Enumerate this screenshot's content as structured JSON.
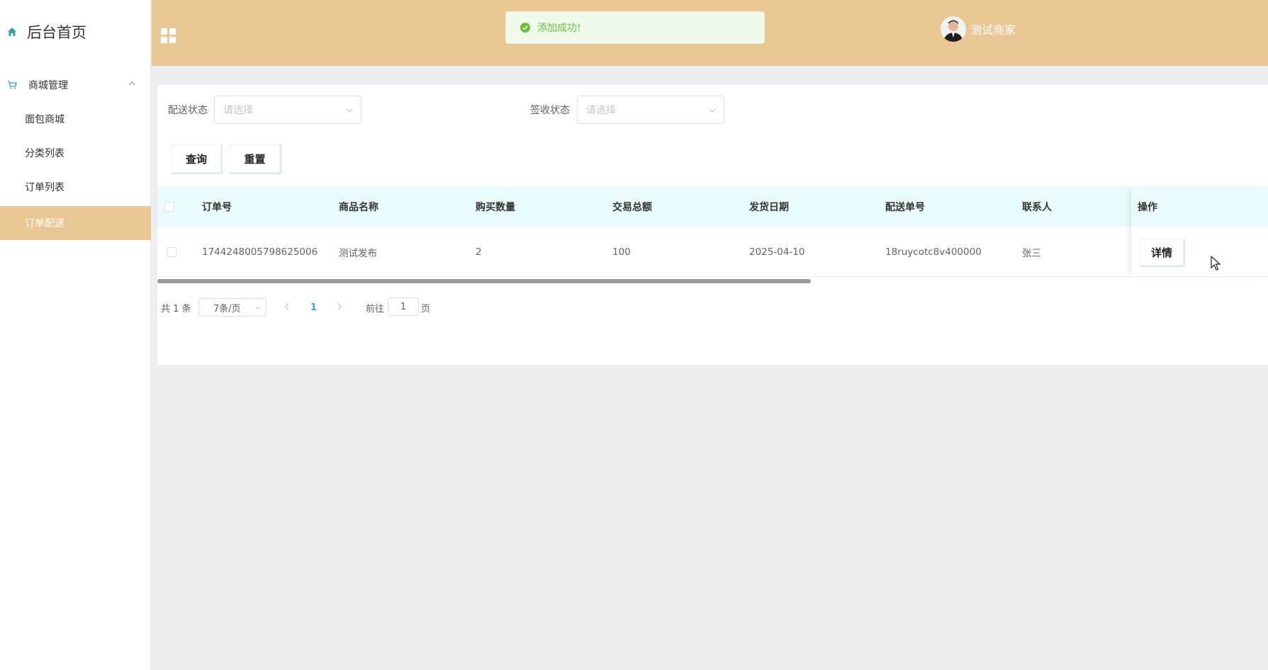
{
  "sidebar": {
    "home_title": "后台首页",
    "group_label": "商城管理",
    "items": [
      {
        "label": "面包商城"
      },
      {
        "label": "分类列表"
      },
      {
        "label": "订单列表"
      },
      {
        "label": "订单配送"
      }
    ]
  },
  "header": {
    "user_name": "测试商家"
  },
  "toast": {
    "message": "添加成功!"
  },
  "filters": {
    "delivery_status_label": "配送状态",
    "delivery_status_placeholder": "请选择",
    "receipt_status_label": "签收状态",
    "receipt_status_placeholder": "请选择",
    "query_button": "查询",
    "reset_button": "重置"
  },
  "table": {
    "columns": [
      "订单号",
      "商品名称",
      "购买数量",
      "交易总额",
      "发货日期",
      "配送单号",
      "联系人",
      "操作"
    ],
    "rows": [
      {
        "order_no": "1744248005798625006",
        "product_name": "测试发布",
        "quantity": "2",
        "total": "100",
        "ship_date": "2025-04-10",
        "tracking_no": "18ruycotc8v400000",
        "contact": "张三",
        "action": "详情"
      }
    ]
  },
  "pagination": {
    "total_text": "共 1 条",
    "page_size": "7条/页",
    "current_page": "1",
    "goto_label": "前往",
    "goto_value": "1",
    "page_unit": "页"
  },
  "colors": {
    "accent": "#e9c795",
    "success": "#67c23a",
    "table_header_bg": "#e9fbfa"
  }
}
